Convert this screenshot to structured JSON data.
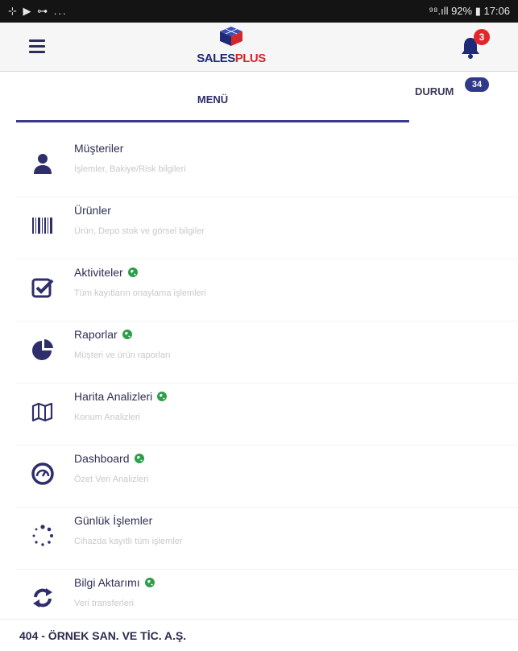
{
  "status_bar": {
    "left_icons": "⊹ ▶ ⊶ ...",
    "right_text": "⁹⁸.ıll 92% ▮ 17:06"
  },
  "app_bar": {
    "brand_left": "SALES",
    "brand_right": "PLUS",
    "notification_count": "3"
  },
  "tabs": {
    "menu_label": "MENÜ",
    "durum_label": "DURUM",
    "durum_count": "34"
  },
  "menu_items": [
    {
      "title": "Müşteriler",
      "subtitle": "İşlemler, Bakiye/Risk bilgileri",
      "icon": "user-icon",
      "online": false
    },
    {
      "title": "Ürünler",
      "subtitle": "Ürün, Depo stok ve görsel bilgiler",
      "icon": "barcode-icon",
      "online": false
    },
    {
      "title": "Aktiviteler",
      "subtitle": "Tüm kayıtların onaylama işlemleri",
      "icon": "checkbox-icon",
      "online": true
    },
    {
      "title": "Raporlar",
      "subtitle": "Müşteri ve ürün raporları",
      "icon": "pie-chart-icon",
      "online": true
    },
    {
      "title": "Harita Analizleri",
      "subtitle": "Konum Analizleri",
      "icon": "map-icon",
      "online": true
    },
    {
      "title": "Dashboard",
      "subtitle": "Özet Veri Analizleri",
      "icon": "dashboard-icon",
      "online": true
    },
    {
      "title": "Günlük İşlemler",
      "subtitle": "Cihazda kayıtlı tüm işlemler",
      "icon": "spinner-icon",
      "online": false
    },
    {
      "title": "Bilgi Aktarımı",
      "subtitle": "Veri transferleri",
      "icon": "sync-icon",
      "online": true
    }
  ],
  "footer": {
    "company": "404 - ÖRNEK SAN. VE TİC. A.Ş."
  },
  "colors": {
    "primary": "#2e2e6a",
    "accent_red": "#e3262b",
    "online_green": "#2e9e4a"
  }
}
